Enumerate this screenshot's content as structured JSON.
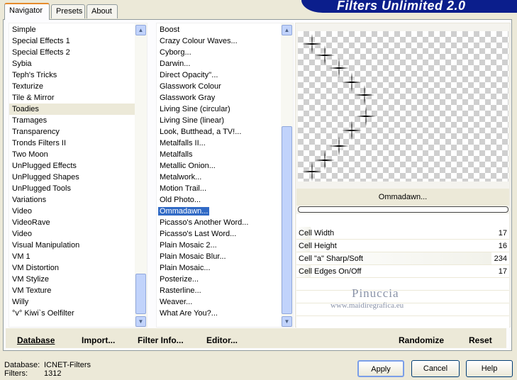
{
  "brand_title": "Filters Unlimited 2.0",
  "tabs": [
    {
      "label": "Navigator",
      "active": true
    },
    {
      "label": "Presets",
      "active": false
    },
    {
      "label": "About",
      "active": false
    }
  ],
  "categories": {
    "items": [
      "Simple",
      "Special Effects 1",
      "Special Effects 2",
      "Sybia",
      "Teph's Tricks",
      "Texturize",
      "Tile & Mirror",
      "Toadies",
      "Tramages",
      "Transparency",
      "Tronds Filters II",
      "Two Moon",
      "UnPlugged Effects",
      "UnPlugged Shapes",
      "UnPlugged Tools",
      "Variations",
      "Video",
      "VideoRave",
      "Video",
      "Visual Manipulation",
      "VM 1",
      "VM Distortion",
      "VM Stylize",
      "VM Texture",
      "Willy",
      "°v° Kiwi`s Oelfilter"
    ],
    "highlighted": "Toadies"
  },
  "filters": {
    "items": [
      "Boost",
      "Crazy Colour Waves...",
      "Cyborg...",
      "Darwin...",
      "Direct Opacity''...",
      "Glasswork Colour",
      "Glasswork Gray",
      "Living Sine (circular)",
      "Living Sine (linear)",
      "Look, Butthead, a TV!...",
      "Metalfalls II...",
      "Metalfalls",
      "Metallic Onion...",
      "Metalwork...",
      "Motion Trail...",
      "Old Photo...",
      "Ommadawn...",
      "Picasso's Another Word...",
      "Picasso's Last Word...",
      "Plain Mosaic 2...",
      "Plain Mosaic Blur...",
      "Plain Mosaic...",
      "Posterize...",
      "Rasterline...",
      "Weaver...",
      "What Are You?..."
    ],
    "selected": "Ommadawn..."
  },
  "preview": {
    "filter_name": "Ommadawn..."
  },
  "params": [
    {
      "label": "Cell Width",
      "value": "17",
      "level": 0.067
    },
    {
      "label": "Cell Height",
      "value": "16",
      "level": 0.063
    },
    {
      "label": "Cell \"a\" Sharp/Soft",
      "value": "234",
      "level": 0.918
    },
    {
      "label": "Cell Edges On/Off",
      "value": "17",
      "level": 0.067
    }
  ],
  "watermark": {
    "line1": "Pinuccia",
    "line2": "www.maidiregrafica.eu"
  },
  "bottom_buttons": {
    "database": "Database",
    "import": "Import...",
    "filter_info": "Filter Info...",
    "editor": "Editor...",
    "randomize": "Randomize",
    "reset": "Reset"
  },
  "status": {
    "database_label": "Database:",
    "database_value": "ICNET-Filters",
    "filters_label": "Filters:",
    "filters_value": "1312"
  },
  "dialog_buttons": {
    "apply": "Apply",
    "cancel": "Cancel",
    "help": "Help"
  },
  "colors": {
    "brand_bg": "#0b1e8c",
    "selection": "#316ac5",
    "tab_accent": "#e68b2c"
  }
}
